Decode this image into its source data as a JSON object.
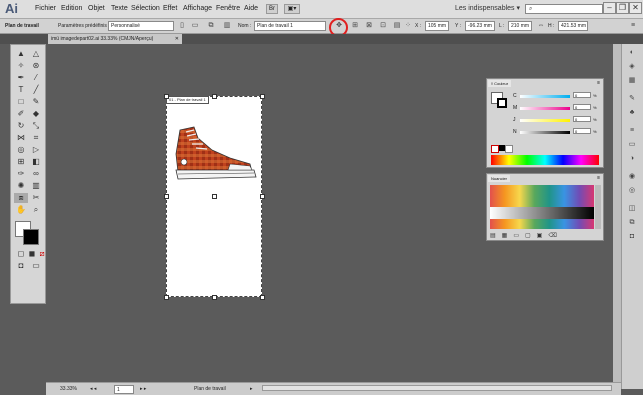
{
  "app": {
    "logo": "Ai"
  },
  "menu": {
    "items": [
      "Fichier",
      "Edition",
      "Objet",
      "Texte",
      "Sélection",
      "Effet",
      "Affichage",
      "Fenêtre",
      "Aide"
    ]
  },
  "menubar": {
    "bridge_btn": "Br",
    "arrange_btn": "▣▾",
    "workspace": "Les indispensables",
    "search_placeholder": ""
  },
  "window_controls": {
    "minimize": "–",
    "restore": "❐",
    "close": "✕"
  },
  "control_bar": {
    "artboard_label": "Plan de travail",
    "preset_label": "Paramètres prédéfinis :",
    "preset_value": "Personnalisé",
    "name_label": "Nom :",
    "name_value": "Plan de travail 1",
    "x_label": "X :",
    "x_value": "105 mm",
    "y_label": "Y :",
    "y_value": "-96.23 mm",
    "l_label": "L :",
    "l_value": "210 mm",
    "h_label": "H :",
    "h_value": "421.53 mm"
  },
  "document_tab": {
    "title": "imü imagedepart02.ai 33.33% (CMJN/Aperçu)",
    "close": "✕"
  },
  "artboard": {
    "label": "01 - Plan de travail 1"
  },
  "color_panel": {
    "tab": "Couleur",
    "sliders": [
      {
        "label": "C",
        "value": "0",
        "unit": "%"
      },
      {
        "label": "M",
        "value": "0",
        "unit": "%"
      },
      {
        "label": "J",
        "value": "0",
        "unit": "%"
      },
      {
        "label": "N",
        "value": "0",
        "unit": "%"
      }
    ]
  },
  "swatches_panel": {
    "tab": "Nuancier"
  },
  "status_bar": {
    "zoom": "33.33%",
    "page": "1",
    "artboard_name": "Plan de travail"
  },
  "colors": {
    "accent_highlight": "#e02020",
    "canvas": "#5b5b5b"
  }
}
